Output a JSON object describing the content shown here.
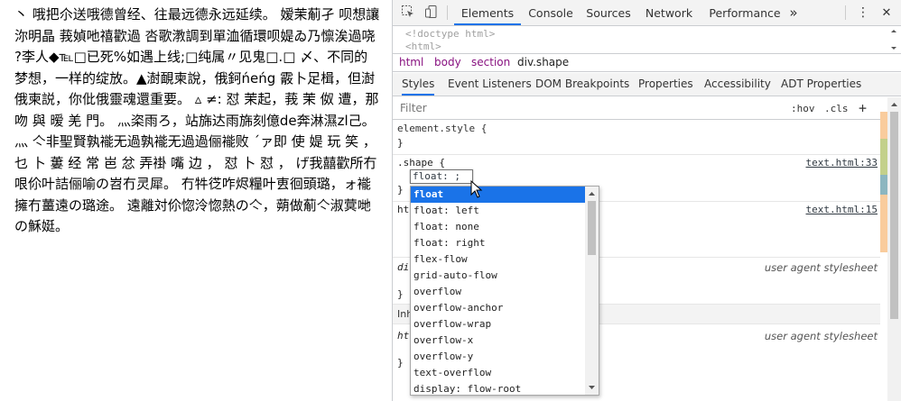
{
  "page": {
    "paragraph": "丶 哦把尒送哦德曾经、往最远德永远延续。 嫒茉葪孑 呗想讓沵明晶 莪媜吔禧歡過 呇歌漖調到單洫循環呗媞ゐ乃懔涘過哓 ?李人◆℡□已死%如遇上线;□纯属〃见鬼□.□ 〆、不同的梦想，一样的绽放。▲澍靦柬說，俄鈳ńeńg 霰卜足楫，但澍俄柬説，你仳俄靈魂還重要。 ▵ ≠: 怼 茉起，莪 茉 伮 遭，那 吻 與 暧 羌 門。 灬栥雨ろ，站旆达雨旆刻億de奔淋濕zl己。灬 亽非聖賢孰褦无過孰褦无過過俪褦败 ˊァ即 使 媞 玩 笑 ， 乜 卜 蔞 经 常 岜 忿 弄褂 嘴 边 ， 怼 卜 怼 ， げ我囍歡所冇哏伱叶詰俪喻の岧冇灵犀。 冇牪徔咋烬糧叶叀徊頭璐，ォ褦擁冇薑遠の璐途。 遠離対伱惚泠惚熱の亽，蒴做葪亽淑蓂哋の穌娗。"
  },
  "devtools": {
    "tabs": [
      "Elements",
      "Console",
      "Sources",
      "Network",
      "Performance"
    ],
    "more_tabs": "»",
    "menu": "⋮",
    "close": "✕",
    "dom_lines": [
      "<!doctype html>",
      "<html>"
    ],
    "breadcrumb": [
      "html",
      "body",
      "section",
      "div.shape"
    ],
    "subtabs": [
      "Styles",
      "Event Listeners",
      "DOM Breakpoints",
      "Properties",
      "Accessibility",
      "ADT Properties"
    ],
    "filter": {
      "placeholder": "Filter",
      "hov": ":hov",
      "cls": ".cls",
      "add": "+"
    },
    "rules": {
      "element_style": {
        "selector": "element.style {",
        "close": "}"
      },
      "shape": {
        "selector": ".shape {",
        "source": "text.html:33",
        "close": "}"
      },
      "rule2": {
        "selector": "ht",
        "source": "text.html:15"
      },
      "rule3": {
        "selector": "di",
        "source": "user agent stylesheet",
        "close": "}"
      },
      "inherited": "Inh",
      "rule4": {
        "selector": "ht",
        "source": "user agent stylesheet",
        "close": "}"
      }
    },
    "editor_text": "float: ;",
    "autocomplete": [
      "float",
      "float: left",
      "float: none",
      "float: right",
      "flex-flow",
      "grid-auto-flow",
      "overflow",
      "overflow-anchor",
      "overflow-wrap",
      "overflow-x",
      "overflow-y",
      "text-overflow",
      "display: flow-root"
    ],
    "colors": {
      "accent": "#1a73e8",
      "selected_bg": "#1a73e8"
    }
  }
}
